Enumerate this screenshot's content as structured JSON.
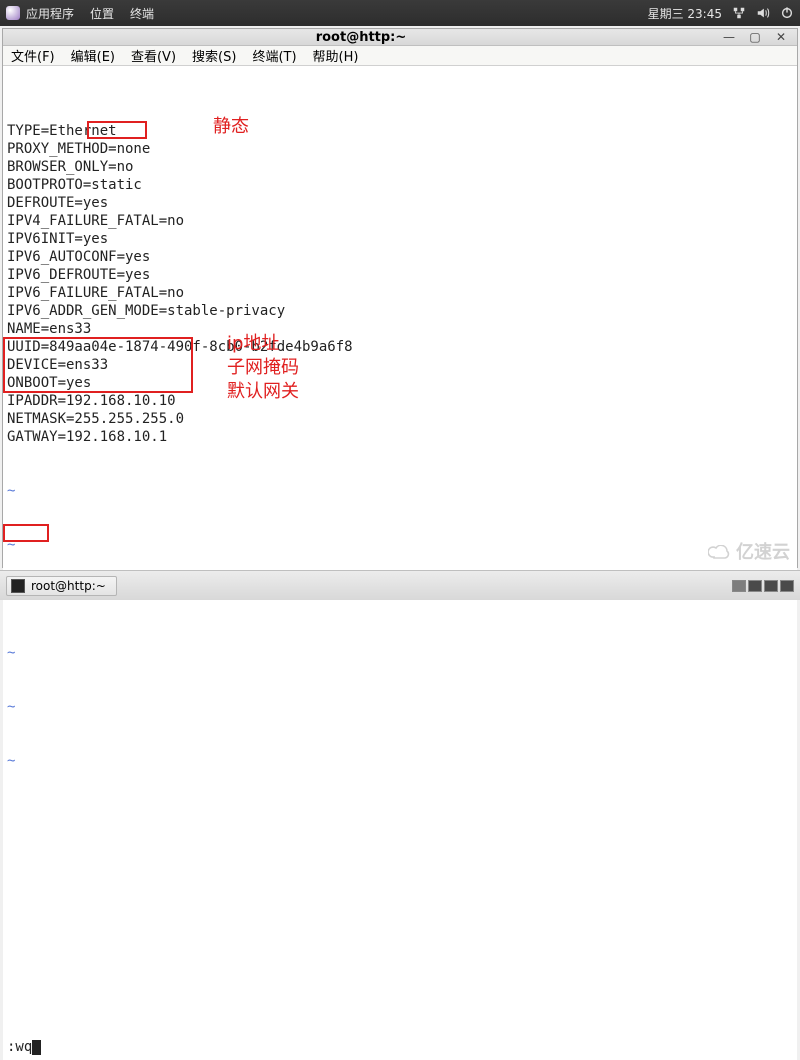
{
  "top_panel": {
    "menus": {
      "apps": "应用程序",
      "places": "位置",
      "terminal": "终端"
    },
    "datetime": "星期三 23:45"
  },
  "window": {
    "title": "root@http:~",
    "menus": {
      "file": "文件(F)",
      "edit": "编辑(E)",
      "view": "查看(V)",
      "search": "搜索(S)",
      "terminal": "终端(T)",
      "help": "帮助(H)"
    }
  },
  "file_content": [
    "TYPE=Ethernet",
    "PROXY_METHOD=none",
    "BROWSER_ONLY=no",
    "BOOTPROTO=static",
    "DEFROUTE=yes",
    "IPV4_FAILURE_FATAL=no",
    "IPV6INIT=yes",
    "IPV6_AUTOCONF=yes",
    "IPV6_DEFROUTE=yes",
    "IPV6_FAILURE_FATAL=no",
    "IPV6_ADDR_GEN_MODE=stable-privacy",
    "NAME=ens33",
    "UUID=849aa04e-1874-490f-8cb0-b2fde4b9a6f8",
    "DEVICE=ens33",
    "ONBOOT=yes",
    "IPADDR=192.168.10.10",
    "NETMASK=255.255.255.0",
    "GATWAY=192.168.10.1"
  ],
  "vim_command": ":wq",
  "annotations": {
    "static": "静态",
    "ip": "ip地址",
    "netmask": "子网掩码",
    "gateway": "默认网关"
  },
  "taskbar": {
    "task": "root@http:~"
  },
  "watermark": "亿速云"
}
